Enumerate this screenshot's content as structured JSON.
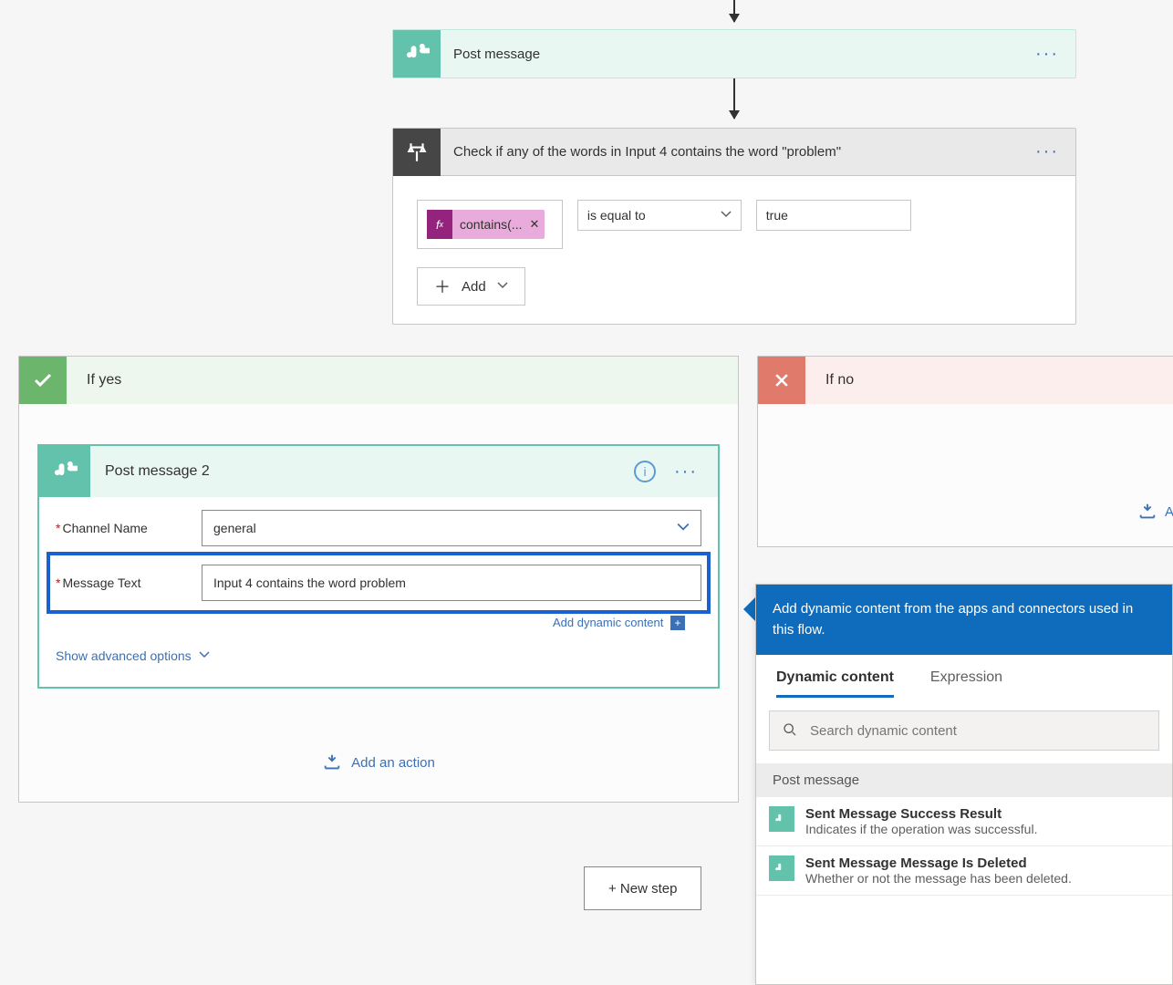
{
  "flow": {
    "post_message_title": "Post message",
    "condition_title": "Check if any of the words in Input 4 contains the word \"problem\"",
    "expr_token": "contains(...",
    "operator": "is equal to",
    "compare_value": "true",
    "add_label": "Add"
  },
  "branches": {
    "yes_label": "If yes",
    "no_label": "If no",
    "add_action": "Add an action",
    "add_action_short": "Add"
  },
  "post2": {
    "title": "Post message 2",
    "channel_label": "Channel Name",
    "channel_value": "general",
    "message_label": "Message Text",
    "message_value": "Input 4 contains the word problem",
    "add_dyn": "Add dynamic content",
    "adv": "Show advanced options"
  },
  "new_step": "+ New step",
  "dyn": {
    "head": "Add dynamic content from the apps and connectors used in this flow.",
    "tab_dc": "Dynamic content",
    "tab_expr": "Expression",
    "search_placeholder": "Search dynamic content",
    "section": "Post message",
    "items": [
      {
        "title": "Sent Message Success Result",
        "desc": "Indicates if the operation was successful."
      },
      {
        "title": "Sent Message Message Is Deleted",
        "desc": "Whether or not the message has been deleted."
      }
    ]
  }
}
